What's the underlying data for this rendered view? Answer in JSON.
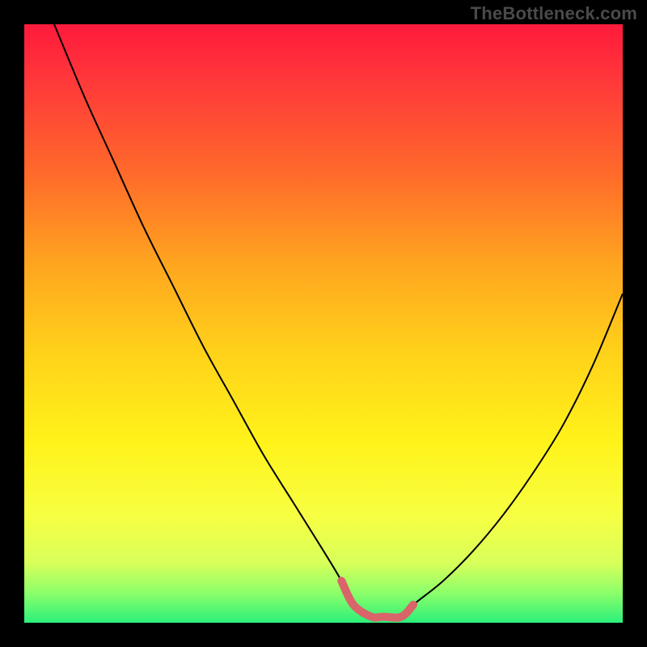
{
  "watermark": {
    "text": "TheBottleneck.com"
  },
  "chart_data": {
    "type": "line",
    "title": "",
    "xlabel": "",
    "ylabel": "",
    "xlim": [
      0,
      100
    ],
    "ylim": [
      0,
      100
    ],
    "series": [
      {
        "name": "curve",
        "x": [
          5,
          10,
          15,
          20,
          25,
          30,
          35,
          40,
          45,
          50,
          53,
          55,
          58,
          60,
          63,
          65,
          70,
          75,
          80,
          85,
          90,
          95,
          100
        ],
        "values": [
          100,
          88,
          77,
          66,
          56,
          46,
          37,
          28,
          20,
          12,
          7,
          3,
          1,
          1,
          1,
          3,
          7,
          12,
          18,
          25,
          33,
          43,
          55
        ]
      },
      {
        "name": "highlight-band",
        "x": [
          53,
          55,
          58,
          60,
          63,
          65
        ],
        "values": [
          7,
          3,
          1,
          1,
          1,
          3
        ]
      }
    ],
    "colors": {
      "curve": "#000000",
      "highlight": "#d9646a",
      "gradient_top": "#ff1a3c",
      "gradient_bottom": "#2bf07a"
    }
  }
}
